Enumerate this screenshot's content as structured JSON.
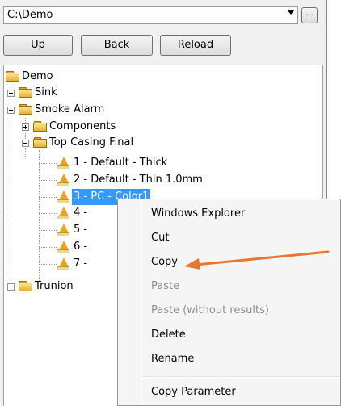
{
  "path_bar": {
    "value": "C:\\Demo",
    "browse_label": "..."
  },
  "nav": {
    "up": "Up",
    "back": "Back",
    "reload": "Reload"
  },
  "tree": {
    "root": "Demo",
    "sink": "Sink",
    "smoke_alarm": "Smoke Alarm",
    "components": "Components",
    "top_casing_final": "Top Casing Final",
    "parts": [
      "1 - Default - Thick",
      "2 - Default - Thin 1.0mm",
      "3 - PC - Color1",
      "4 -",
      "5 -",
      "6 -",
      "7 -"
    ],
    "trunion": "Trunion"
  },
  "context_menu": {
    "items": [
      {
        "label": "Windows Explorer",
        "enabled": true
      },
      {
        "label": "Cut",
        "enabled": true
      },
      {
        "label": "Copy",
        "enabled": true
      },
      {
        "label": "Paste",
        "enabled": false
      },
      {
        "label": "Paste (without results)",
        "enabled": false
      },
      {
        "label": "Delete",
        "enabled": true
      },
      {
        "label": "Rename",
        "enabled": true
      },
      {
        "label": "Copy Parameter",
        "enabled": true
      }
    ]
  },
  "colors": {
    "selection": "#3399ff",
    "annotation_arrow": "#e8772e"
  }
}
